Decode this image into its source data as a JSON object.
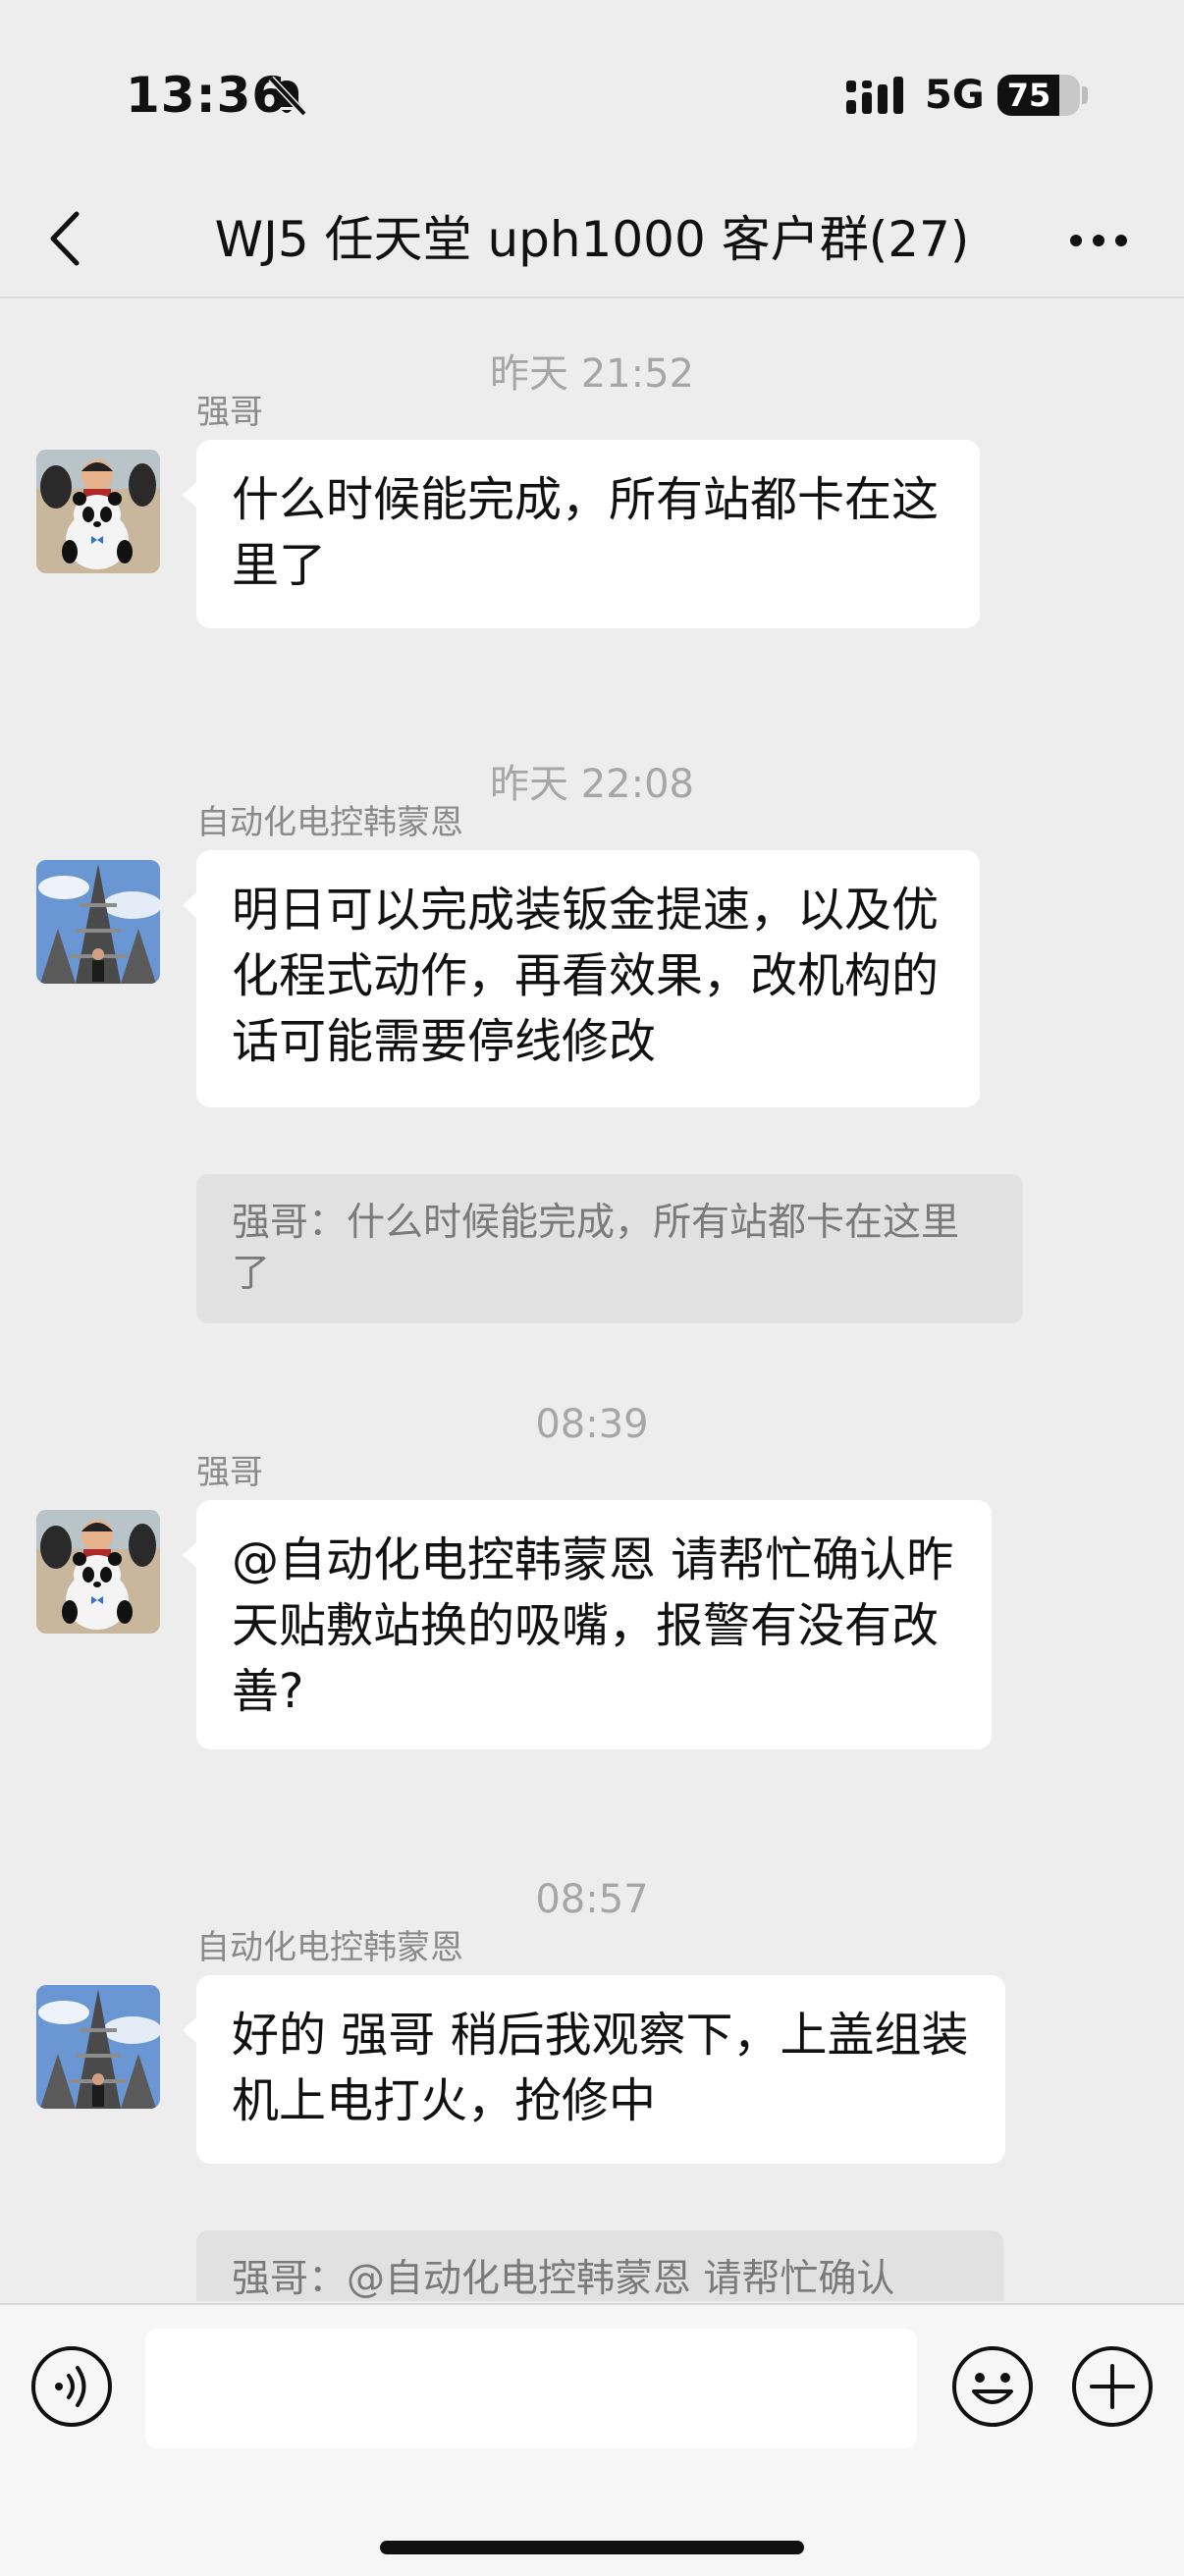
{
  "status_bar": {
    "time": "13:36",
    "network": "5G",
    "battery_level": "75",
    "battery_fraction": 0.75,
    "icons": [
      "bell-muted-icon",
      "signal-icon"
    ]
  },
  "nav": {
    "title": "WJ5 任天堂 uph1000 客户群(27)",
    "icons": [
      "back-icon",
      "more-icon"
    ]
  },
  "messages": [
    {
      "timestamp": "昨天 21:52",
      "sender": "强哥",
      "avatar": "panda-avatar",
      "text": "什么时候能完成，所有站都卡在这里了"
    },
    {
      "timestamp": "昨天 22:08",
      "sender": "自动化电控韩蒙恩",
      "avatar": "temple-avatar",
      "text": "明日可以完成装钣金提速，以及优化程式动作，再看效果，改机构的话可能需要停线修改",
      "quote": "强哥：什么时候能完成，所有站都卡在这里了"
    },
    {
      "timestamp": "08:39",
      "sender": "强哥",
      "avatar": "panda-avatar",
      "text": "@自动化电控韩蒙恩 请帮忙确认昨天贴敷站换的吸嘴，报警有没有改善?"
    },
    {
      "timestamp": "08:57",
      "sender": "自动化电控韩蒙恩",
      "avatar": "temple-avatar",
      "text": "好的 强哥 稍后我观察下，上盖组装机上电打火，抢修中",
      "quote": "强哥：@自动化电控韩蒙恩 请帮忙确认"
    }
  ],
  "input_bar": {
    "placeholder": "",
    "icons": [
      "voice-icon",
      "emoji-icon",
      "plus-icon"
    ]
  },
  "colors": {
    "background": "#ededed",
    "bubble": "#ffffff",
    "quote": "#e1e1e1",
    "timestamp": "#a6a6a6"
  }
}
